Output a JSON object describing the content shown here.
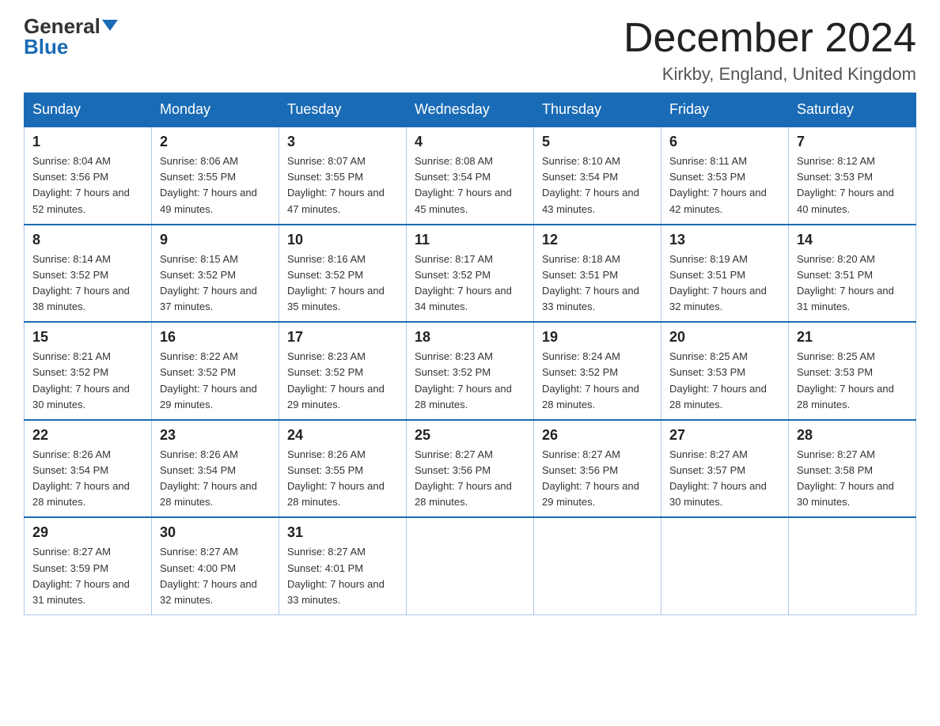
{
  "logo": {
    "general": "General",
    "blue": "Blue"
  },
  "title": "December 2024",
  "location": "Kirkby, England, United Kingdom",
  "days_of_week": [
    "Sunday",
    "Monday",
    "Tuesday",
    "Wednesday",
    "Thursday",
    "Friday",
    "Saturday"
  ],
  "weeks": [
    [
      {
        "day": "1",
        "sunrise": "8:04 AM",
        "sunset": "3:56 PM",
        "daylight": "7 hours and 52 minutes."
      },
      {
        "day": "2",
        "sunrise": "8:06 AM",
        "sunset": "3:55 PM",
        "daylight": "7 hours and 49 minutes."
      },
      {
        "day": "3",
        "sunrise": "8:07 AM",
        "sunset": "3:55 PM",
        "daylight": "7 hours and 47 minutes."
      },
      {
        "day": "4",
        "sunrise": "8:08 AM",
        "sunset": "3:54 PM",
        "daylight": "7 hours and 45 minutes."
      },
      {
        "day": "5",
        "sunrise": "8:10 AM",
        "sunset": "3:54 PM",
        "daylight": "7 hours and 43 minutes."
      },
      {
        "day": "6",
        "sunrise": "8:11 AM",
        "sunset": "3:53 PM",
        "daylight": "7 hours and 42 minutes."
      },
      {
        "day": "7",
        "sunrise": "8:12 AM",
        "sunset": "3:53 PM",
        "daylight": "7 hours and 40 minutes."
      }
    ],
    [
      {
        "day": "8",
        "sunrise": "8:14 AM",
        "sunset": "3:52 PM",
        "daylight": "7 hours and 38 minutes."
      },
      {
        "day": "9",
        "sunrise": "8:15 AM",
        "sunset": "3:52 PM",
        "daylight": "7 hours and 37 minutes."
      },
      {
        "day": "10",
        "sunrise": "8:16 AM",
        "sunset": "3:52 PM",
        "daylight": "7 hours and 35 minutes."
      },
      {
        "day": "11",
        "sunrise": "8:17 AM",
        "sunset": "3:52 PM",
        "daylight": "7 hours and 34 minutes."
      },
      {
        "day": "12",
        "sunrise": "8:18 AM",
        "sunset": "3:51 PM",
        "daylight": "7 hours and 33 minutes."
      },
      {
        "day": "13",
        "sunrise": "8:19 AM",
        "sunset": "3:51 PM",
        "daylight": "7 hours and 32 minutes."
      },
      {
        "day": "14",
        "sunrise": "8:20 AM",
        "sunset": "3:51 PM",
        "daylight": "7 hours and 31 minutes."
      }
    ],
    [
      {
        "day": "15",
        "sunrise": "8:21 AM",
        "sunset": "3:52 PM",
        "daylight": "7 hours and 30 minutes."
      },
      {
        "day": "16",
        "sunrise": "8:22 AM",
        "sunset": "3:52 PM",
        "daylight": "7 hours and 29 minutes."
      },
      {
        "day": "17",
        "sunrise": "8:23 AM",
        "sunset": "3:52 PM",
        "daylight": "7 hours and 29 minutes."
      },
      {
        "day": "18",
        "sunrise": "8:23 AM",
        "sunset": "3:52 PM",
        "daylight": "7 hours and 28 minutes."
      },
      {
        "day": "19",
        "sunrise": "8:24 AM",
        "sunset": "3:52 PM",
        "daylight": "7 hours and 28 minutes."
      },
      {
        "day": "20",
        "sunrise": "8:25 AM",
        "sunset": "3:53 PM",
        "daylight": "7 hours and 28 minutes."
      },
      {
        "day": "21",
        "sunrise": "8:25 AM",
        "sunset": "3:53 PM",
        "daylight": "7 hours and 28 minutes."
      }
    ],
    [
      {
        "day": "22",
        "sunrise": "8:26 AM",
        "sunset": "3:54 PM",
        "daylight": "7 hours and 28 minutes."
      },
      {
        "day": "23",
        "sunrise": "8:26 AM",
        "sunset": "3:54 PM",
        "daylight": "7 hours and 28 minutes."
      },
      {
        "day": "24",
        "sunrise": "8:26 AM",
        "sunset": "3:55 PM",
        "daylight": "7 hours and 28 minutes."
      },
      {
        "day": "25",
        "sunrise": "8:27 AM",
        "sunset": "3:56 PM",
        "daylight": "7 hours and 28 minutes."
      },
      {
        "day": "26",
        "sunrise": "8:27 AM",
        "sunset": "3:56 PM",
        "daylight": "7 hours and 29 minutes."
      },
      {
        "day": "27",
        "sunrise": "8:27 AM",
        "sunset": "3:57 PM",
        "daylight": "7 hours and 30 minutes."
      },
      {
        "day": "28",
        "sunrise": "8:27 AM",
        "sunset": "3:58 PM",
        "daylight": "7 hours and 30 minutes."
      }
    ],
    [
      {
        "day": "29",
        "sunrise": "8:27 AM",
        "sunset": "3:59 PM",
        "daylight": "7 hours and 31 minutes."
      },
      {
        "day": "30",
        "sunrise": "8:27 AM",
        "sunset": "4:00 PM",
        "daylight": "7 hours and 32 minutes."
      },
      {
        "day": "31",
        "sunrise": "8:27 AM",
        "sunset": "4:01 PM",
        "daylight": "7 hours and 33 minutes."
      },
      null,
      null,
      null,
      null
    ]
  ]
}
